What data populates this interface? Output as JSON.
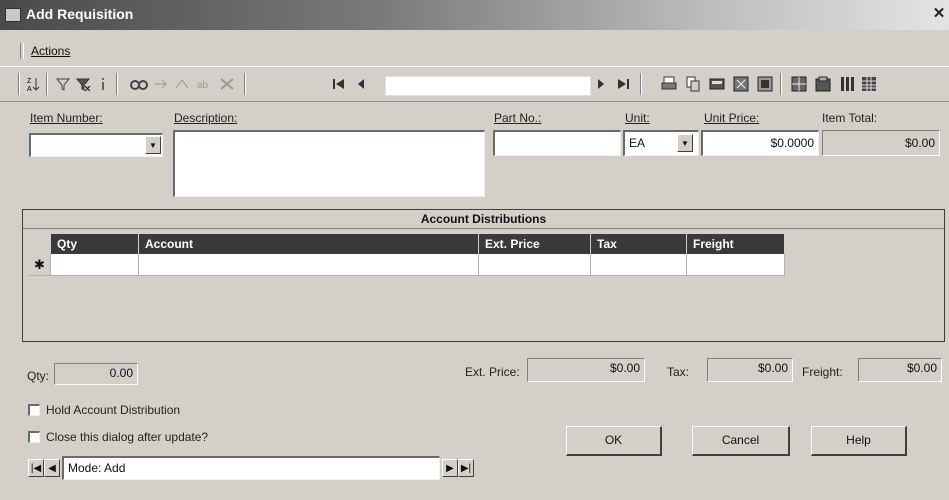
{
  "window": {
    "title": "Add Requisition",
    "close_glyph": "✕"
  },
  "menu": {
    "actions": "Actions"
  },
  "toolbar": {
    "icons": [
      "sort-az-icon",
      "filter-icon",
      "clear-filter-icon",
      "info-icon",
      "find-icon",
      "find-next-icon",
      "replace-icon",
      "edit-icon",
      "delete-icon",
      "first-record-icon",
      "previous-record-icon",
      "next-record-icon",
      "last-record-icon",
      "print-icon",
      "copy-icon",
      "print-preview-icon",
      "export-icon",
      "attach-icon",
      "layout-icon",
      "properties-icon",
      "columns-icon",
      "grid-icon"
    ],
    "record_value": ""
  },
  "fields": {
    "item_number_label": "Item Number:",
    "item_number_value": "",
    "description_label": "Description:",
    "description_value": "",
    "part_no_label": "Part No.:",
    "part_no_value": "",
    "unit_label": "Unit:",
    "unit_value": "EA",
    "unit_price_label": "Unit Price:",
    "unit_price_value": "$0.0000",
    "item_total_label": "Item Total:",
    "item_total_value": "$0.00"
  },
  "grid": {
    "title": "Account Distributions",
    "columns": [
      "Qty",
      "Account",
      "Ext. Price",
      "Tax",
      "Freight"
    ],
    "new_row_marker": "✱"
  },
  "totals": {
    "qty_label": "Qty:",
    "qty_value": "0.00",
    "ext_price_label": "Ext. Price:",
    "ext_price_value": "$0.00",
    "tax_label": "Tax:",
    "tax_value": "$0.00",
    "freight_label": "Freight:",
    "freight_value": "$0.00"
  },
  "options": {
    "hold_distribution": "Hold Account Distribution",
    "close_after_update": "Close this dialog after update?"
  },
  "buttons": {
    "ok": "OK",
    "cancel": "Cancel",
    "help": "Help"
  },
  "status": {
    "mode": "Mode: Add"
  }
}
